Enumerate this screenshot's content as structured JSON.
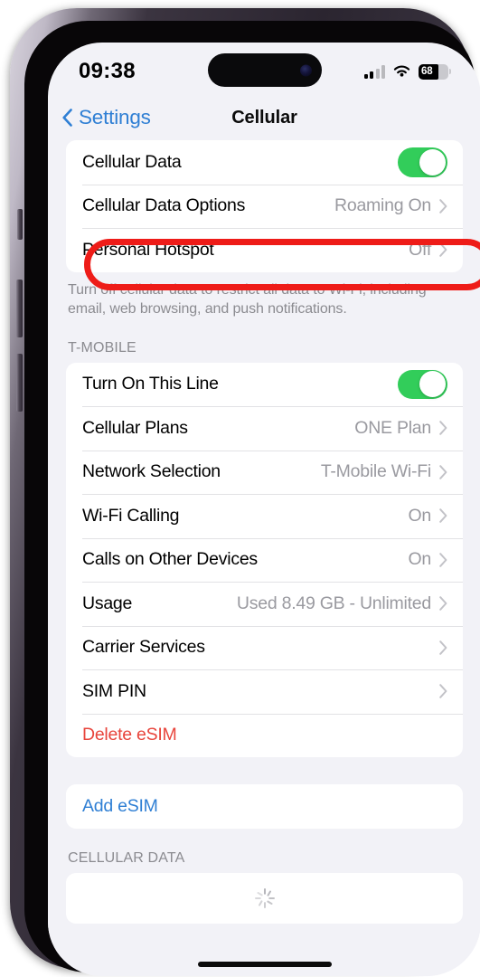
{
  "status_bar": {
    "time": "09:38",
    "battery_level": "68",
    "signal_icon": "cellular-bars-icon",
    "wifi_icon": "wifi-icon",
    "battery_icon": "battery-icon"
  },
  "nav": {
    "back_label": "Settings",
    "title": "Cellular"
  },
  "groups": [
    {
      "id": "data-group",
      "rows": [
        {
          "label": "Cellular Data",
          "control": "toggle",
          "toggle_on": true
        },
        {
          "label": "Cellular Data Options",
          "value": "Roaming On",
          "control": "chevron"
        },
        {
          "label": "Personal Hotspot",
          "value": "Off",
          "control": "chevron"
        }
      ],
      "footer": "Turn off cellular data to restrict all data to Wi-Fi, including email, web browsing, and push notifications."
    },
    {
      "id": "tmobile-group",
      "header": "T-MOBILE",
      "rows": [
        {
          "label": "Turn On This Line",
          "control": "toggle",
          "toggle_on": true
        },
        {
          "label": "Cellular Plans",
          "value": "ONE Plan",
          "control": "chevron"
        },
        {
          "label": "Network Selection",
          "value": "T-Mobile Wi-Fi",
          "control": "chevron"
        },
        {
          "label": "Wi-Fi Calling",
          "value": "On",
          "control": "chevron"
        },
        {
          "label": "Calls on Other Devices",
          "value": "On",
          "control": "chevron"
        },
        {
          "label": "Usage",
          "value": "Used 8.49 GB - Unlimited",
          "control": "chevron"
        },
        {
          "label": "Carrier Services",
          "value": "",
          "control": "chevron"
        },
        {
          "label": "SIM PIN",
          "value": "",
          "control": "chevron"
        },
        {
          "label": "Delete eSIM",
          "value": "",
          "control": "none",
          "style": "destructive"
        }
      ]
    },
    {
      "id": "add-esim-group",
      "rows": [
        {
          "label": "Add eSIM",
          "value": "",
          "control": "none",
          "style": "link"
        }
      ]
    },
    {
      "id": "cellular-data-group",
      "header": "CELLULAR DATA",
      "rows": [],
      "loading": true,
      "loading_icon": "activity-spinner-icon"
    }
  ],
  "annotation": {
    "shape": "ellipse",
    "color": "#ee1c18",
    "targets": "Cellular Data Options"
  },
  "colors": {
    "accent_blue": "#2f7fd4",
    "toggle_green": "#32cd5a",
    "destructive_red": "#e8453c",
    "value_gray": "#9a9aa0",
    "background_gray": "#f2f2f7",
    "annotation_red": "#ee1c18"
  }
}
